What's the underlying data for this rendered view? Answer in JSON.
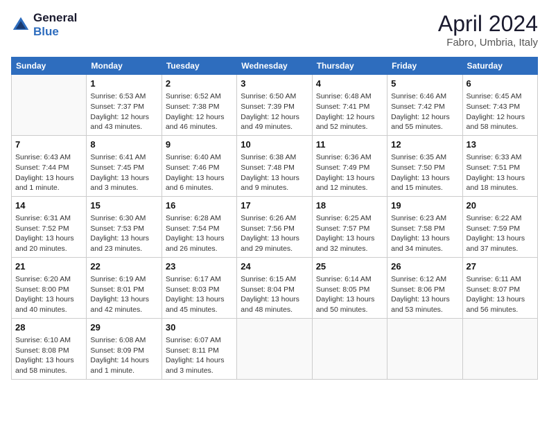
{
  "header": {
    "logo_line1": "General",
    "logo_line2": "Blue",
    "month": "April 2024",
    "location": "Fabro, Umbria, Italy"
  },
  "weekdays": [
    "Sunday",
    "Monday",
    "Tuesday",
    "Wednesday",
    "Thursday",
    "Friday",
    "Saturday"
  ],
  "weeks": [
    [
      {
        "day": "",
        "info": ""
      },
      {
        "day": "1",
        "info": "Sunrise: 6:53 AM\nSunset: 7:37 PM\nDaylight: 12 hours\nand 43 minutes."
      },
      {
        "day": "2",
        "info": "Sunrise: 6:52 AM\nSunset: 7:38 PM\nDaylight: 12 hours\nand 46 minutes."
      },
      {
        "day": "3",
        "info": "Sunrise: 6:50 AM\nSunset: 7:39 PM\nDaylight: 12 hours\nand 49 minutes."
      },
      {
        "day": "4",
        "info": "Sunrise: 6:48 AM\nSunset: 7:41 PM\nDaylight: 12 hours\nand 52 minutes."
      },
      {
        "day": "5",
        "info": "Sunrise: 6:46 AM\nSunset: 7:42 PM\nDaylight: 12 hours\nand 55 minutes."
      },
      {
        "day": "6",
        "info": "Sunrise: 6:45 AM\nSunset: 7:43 PM\nDaylight: 12 hours\nand 58 minutes."
      }
    ],
    [
      {
        "day": "7",
        "info": "Sunrise: 6:43 AM\nSunset: 7:44 PM\nDaylight: 13 hours\nand 1 minute."
      },
      {
        "day": "8",
        "info": "Sunrise: 6:41 AM\nSunset: 7:45 PM\nDaylight: 13 hours\nand 3 minutes."
      },
      {
        "day": "9",
        "info": "Sunrise: 6:40 AM\nSunset: 7:46 PM\nDaylight: 13 hours\nand 6 minutes."
      },
      {
        "day": "10",
        "info": "Sunrise: 6:38 AM\nSunset: 7:48 PM\nDaylight: 13 hours\nand 9 minutes."
      },
      {
        "day": "11",
        "info": "Sunrise: 6:36 AM\nSunset: 7:49 PM\nDaylight: 13 hours\nand 12 minutes."
      },
      {
        "day": "12",
        "info": "Sunrise: 6:35 AM\nSunset: 7:50 PM\nDaylight: 13 hours\nand 15 minutes."
      },
      {
        "day": "13",
        "info": "Sunrise: 6:33 AM\nSunset: 7:51 PM\nDaylight: 13 hours\nand 18 minutes."
      }
    ],
    [
      {
        "day": "14",
        "info": "Sunrise: 6:31 AM\nSunset: 7:52 PM\nDaylight: 13 hours\nand 20 minutes."
      },
      {
        "day": "15",
        "info": "Sunrise: 6:30 AM\nSunset: 7:53 PM\nDaylight: 13 hours\nand 23 minutes."
      },
      {
        "day": "16",
        "info": "Sunrise: 6:28 AM\nSunset: 7:54 PM\nDaylight: 13 hours\nand 26 minutes."
      },
      {
        "day": "17",
        "info": "Sunrise: 6:26 AM\nSunset: 7:56 PM\nDaylight: 13 hours\nand 29 minutes."
      },
      {
        "day": "18",
        "info": "Sunrise: 6:25 AM\nSunset: 7:57 PM\nDaylight: 13 hours\nand 32 minutes."
      },
      {
        "day": "19",
        "info": "Sunrise: 6:23 AM\nSunset: 7:58 PM\nDaylight: 13 hours\nand 34 minutes."
      },
      {
        "day": "20",
        "info": "Sunrise: 6:22 AM\nSunset: 7:59 PM\nDaylight: 13 hours\nand 37 minutes."
      }
    ],
    [
      {
        "day": "21",
        "info": "Sunrise: 6:20 AM\nSunset: 8:00 PM\nDaylight: 13 hours\nand 40 minutes."
      },
      {
        "day": "22",
        "info": "Sunrise: 6:19 AM\nSunset: 8:01 PM\nDaylight: 13 hours\nand 42 minutes."
      },
      {
        "day": "23",
        "info": "Sunrise: 6:17 AM\nSunset: 8:03 PM\nDaylight: 13 hours\nand 45 minutes."
      },
      {
        "day": "24",
        "info": "Sunrise: 6:15 AM\nSunset: 8:04 PM\nDaylight: 13 hours\nand 48 minutes."
      },
      {
        "day": "25",
        "info": "Sunrise: 6:14 AM\nSunset: 8:05 PM\nDaylight: 13 hours\nand 50 minutes."
      },
      {
        "day": "26",
        "info": "Sunrise: 6:12 AM\nSunset: 8:06 PM\nDaylight: 13 hours\nand 53 minutes."
      },
      {
        "day": "27",
        "info": "Sunrise: 6:11 AM\nSunset: 8:07 PM\nDaylight: 13 hours\nand 56 minutes."
      }
    ],
    [
      {
        "day": "28",
        "info": "Sunrise: 6:10 AM\nSunset: 8:08 PM\nDaylight: 13 hours\nand 58 minutes."
      },
      {
        "day": "29",
        "info": "Sunrise: 6:08 AM\nSunset: 8:09 PM\nDaylight: 14 hours\nand 1 minute."
      },
      {
        "day": "30",
        "info": "Sunrise: 6:07 AM\nSunset: 8:11 PM\nDaylight: 14 hours\nand 3 minutes."
      },
      {
        "day": "",
        "info": ""
      },
      {
        "day": "",
        "info": ""
      },
      {
        "day": "",
        "info": ""
      },
      {
        "day": "",
        "info": ""
      }
    ]
  ]
}
